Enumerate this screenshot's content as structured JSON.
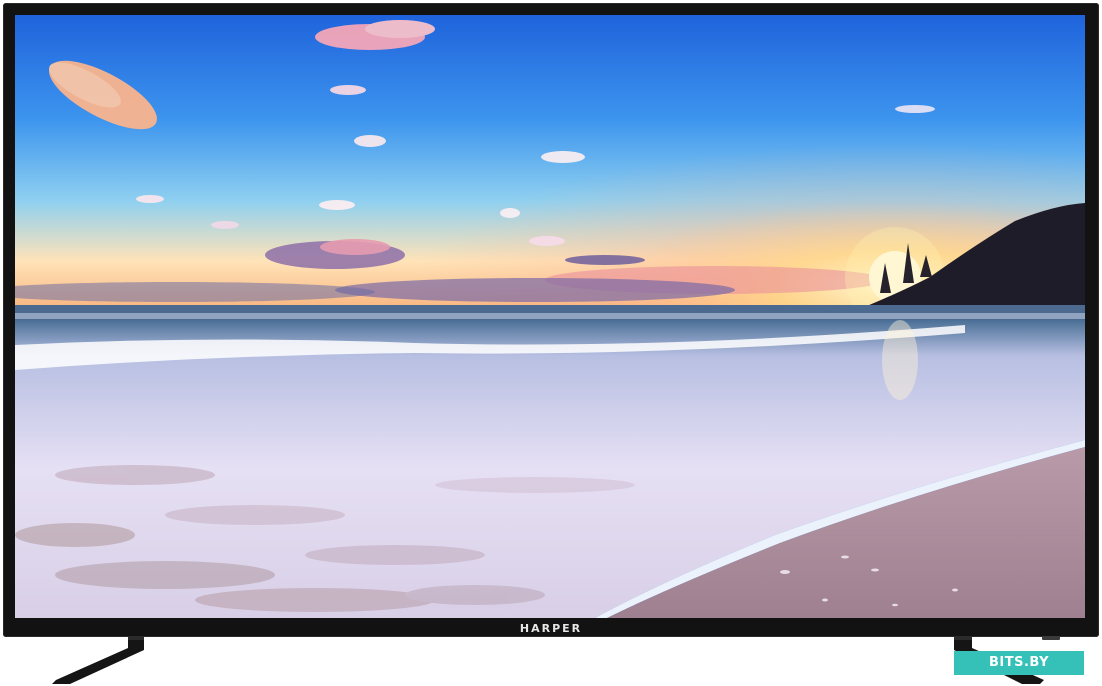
{
  "product": {
    "brand_logo_text": "HARPER",
    "screen_content": "beach-sunset-wallpaper"
  },
  "watermark": {
    "text": "BITS.BY"
  },
  "colors": {
    "bezel": "#121212",
    "sky_top": "#2a6fe0",
    "sky_horizon": "#ffd9a8",
    "sun": "#fff4c8",
    "sea": "#d8d6f0",
    "sand": "#a88a9a",
    "watermark_bg": "#35c1b8"
  }
}
